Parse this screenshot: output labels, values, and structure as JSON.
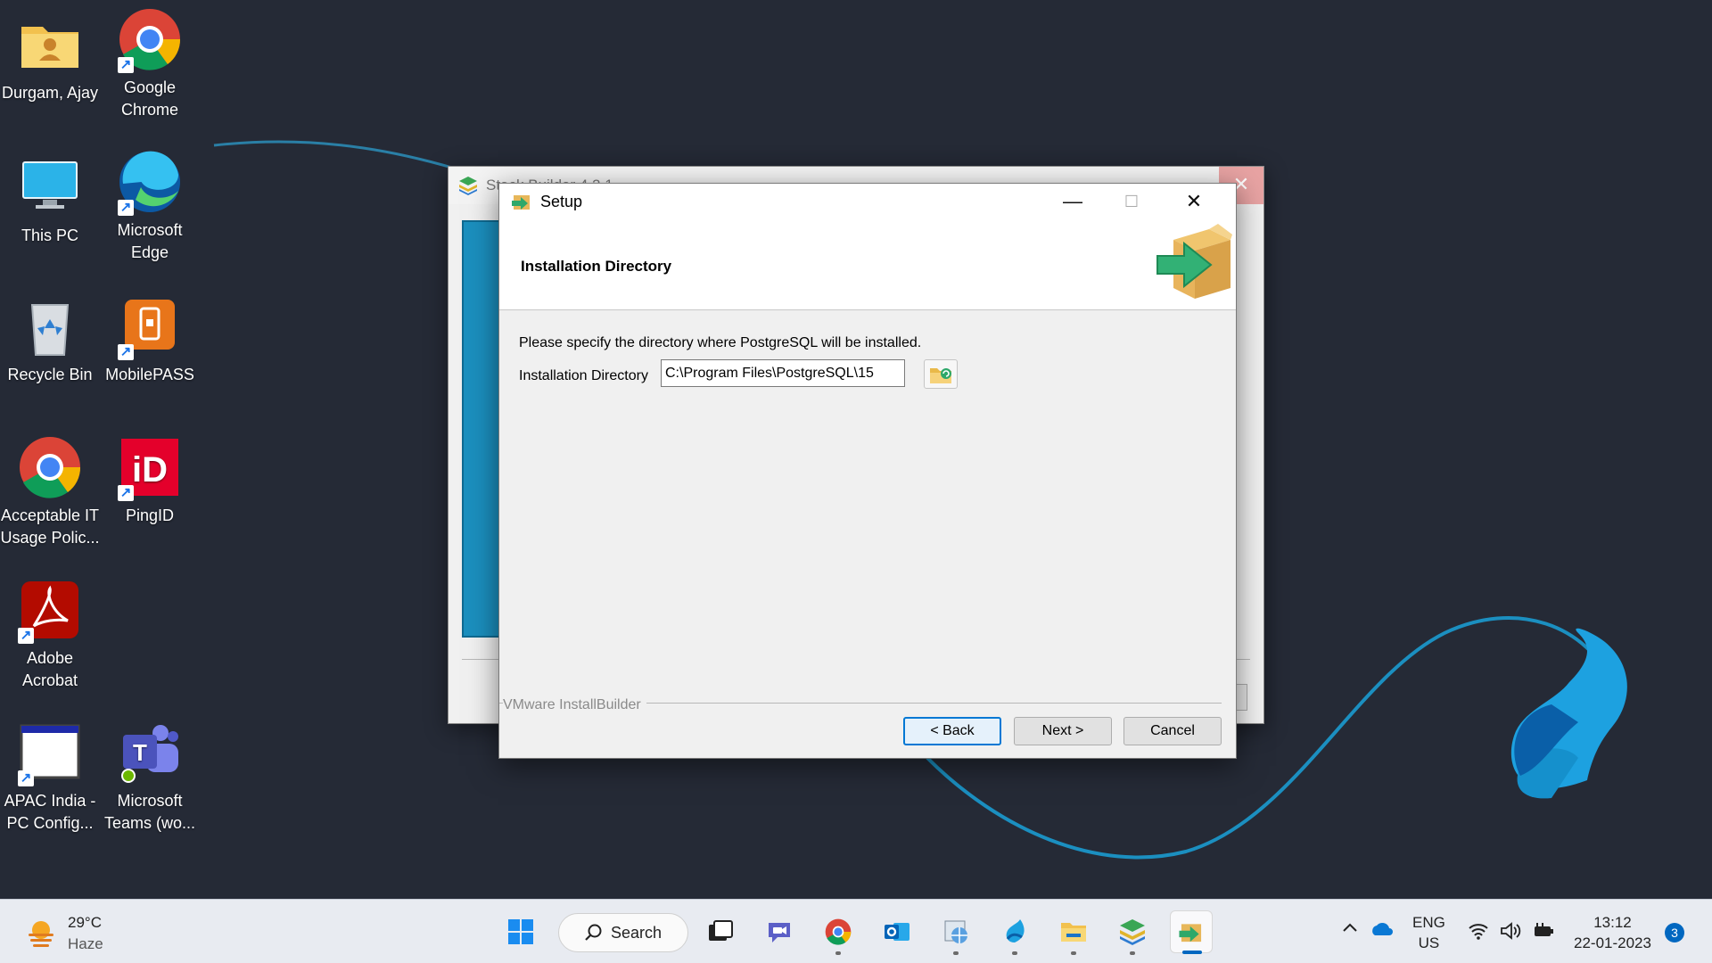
{
  "desktop": {
    "icons": [
      {
        "label": "Durgam, Ajay",
        "icon": "user-folder-icon"
      },
      {
        "label": "Google Chrome",
        "icon": "chrome-icon"
      },
      {
        "label": "This PC",
        "icon": "monitor-icon"
      },
      {
        "label": "Microsoft Edge",
        "icon": "edge-icon"
      },
      {
        "label": "Recycle Bin",
        "icon": "recycle-bin-icon"
      },
      {
        "label": "MobilePASS",
        "icon": "mobilepass-icon"
      },
      {
        "label": "Acceptable IT Usage Polic...",
        "icon": "chrome-icon"
      },
      {
        "label": "PingID",
        "icon": "pingid-icon"
      },
      {
        "label": "Adobe Acrobat",
        "icon": "acrobat-icon"
      },
      {
        "label": "APAC India - PC Config...",
        "icon": "window-app-icon"
      },
      {
        "label": "Microsoft Teams (wo...",
        "icon": "teams-icon"
      }
    ]
  },
  "background_window": {
    "title": "Stack Builder 4.2.1"
  },
  "setup": {
    "title": "Setup",
    "header_title": "Installation Directory",
    "description": "Please specify the directory where PostgreSQL will be installed.",
    "dir_label": "Installation Directory",
    "dir_value": "C:\\Program Files\\PostgreSQL\\15",
    "brand": "VMware InstallBuilder",
    "back_label": "< Back",
    "next_label": "Next >",
    "cancel_label": "Cancel",
    "minimize_glyph": "—",
    "maximize_glyph": "☐",
    "close_glyph": "✕"
  },
  "taskbar": {
    "weather_temp": "29°C",
    "weather_cond": "Haze",
    "search_label": "Search",
    "lang_line1": "ENG",
    "lang_line2": "US",
    "time": "13:12",
    "date": "22-01-2023",
    "notification_count": "3",
    "accent": "#0067c0"
  }
}
